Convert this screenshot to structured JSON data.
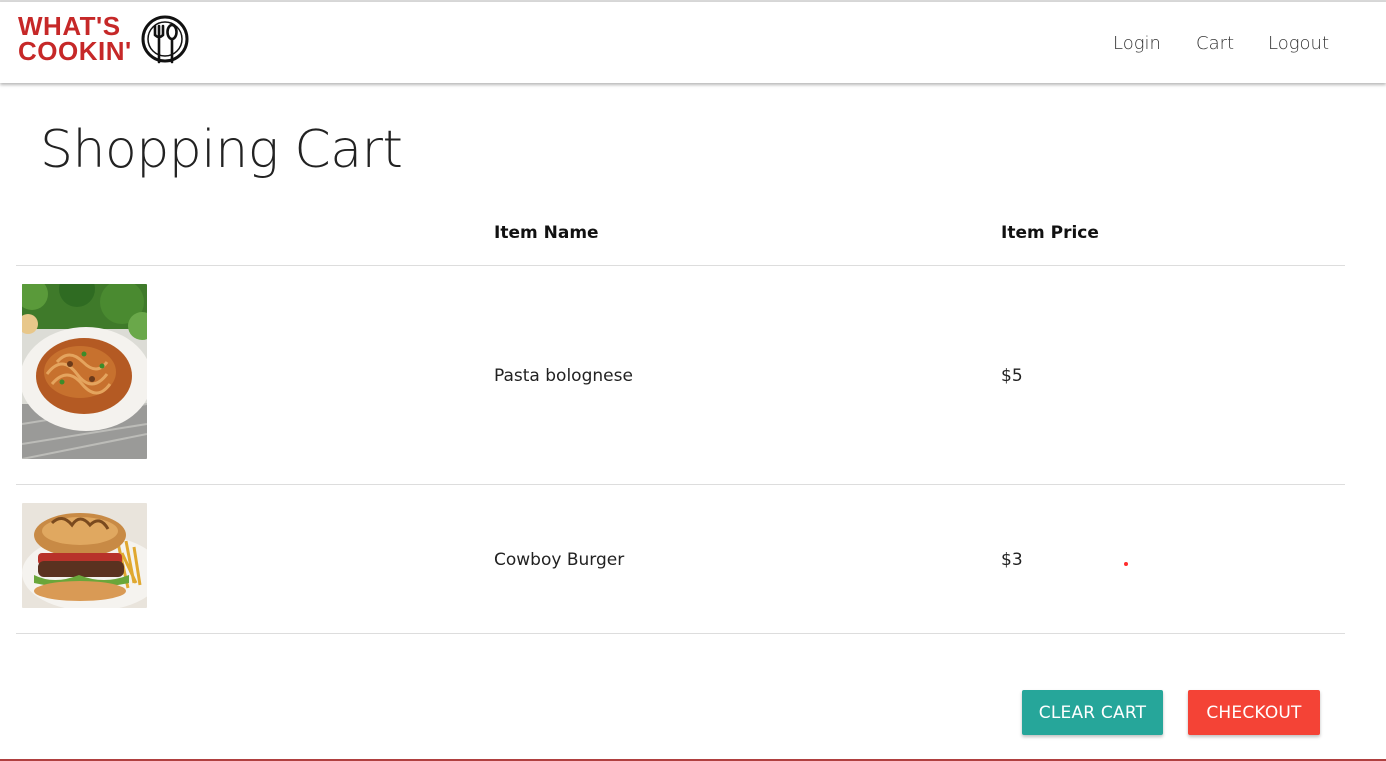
{
  "brand": {
    "line1": "WHAT'S",
    "line2": "COOKIN'",
    "icon": "fork-spoon-plate-icon",
    "color": "#c62828"
  },
  "nav": {
    "links": [
      {
        "label": "Login"
      },
      {
        "label": "Cart"
      },
      {
        "label": "Logout"
      }
    ]
  },
  "page": {
    "title": "Shopping Cart"
  },
  "table": {
    "headers": {
      "image": "",
      "name": "Item Name",
      "price": "Item Price"
    },
    "rows": [
      {
        "name": "Pasta bolognese",
        "price": "$5",
        "image": "pasta-bolognese-photo"
      },
      {
        "name": "Cowboy Burger",
        "price": "$3",
        "image": "cowboy-burger-photo"
      }
    ]
  },
  "actions": {
    "clear_label": "CLEAR CART",
    "checkout_label": "CHECKOUT",
    "clear_color": "#26a69a",
    "checkout_color": "#f44336"
  }
}
